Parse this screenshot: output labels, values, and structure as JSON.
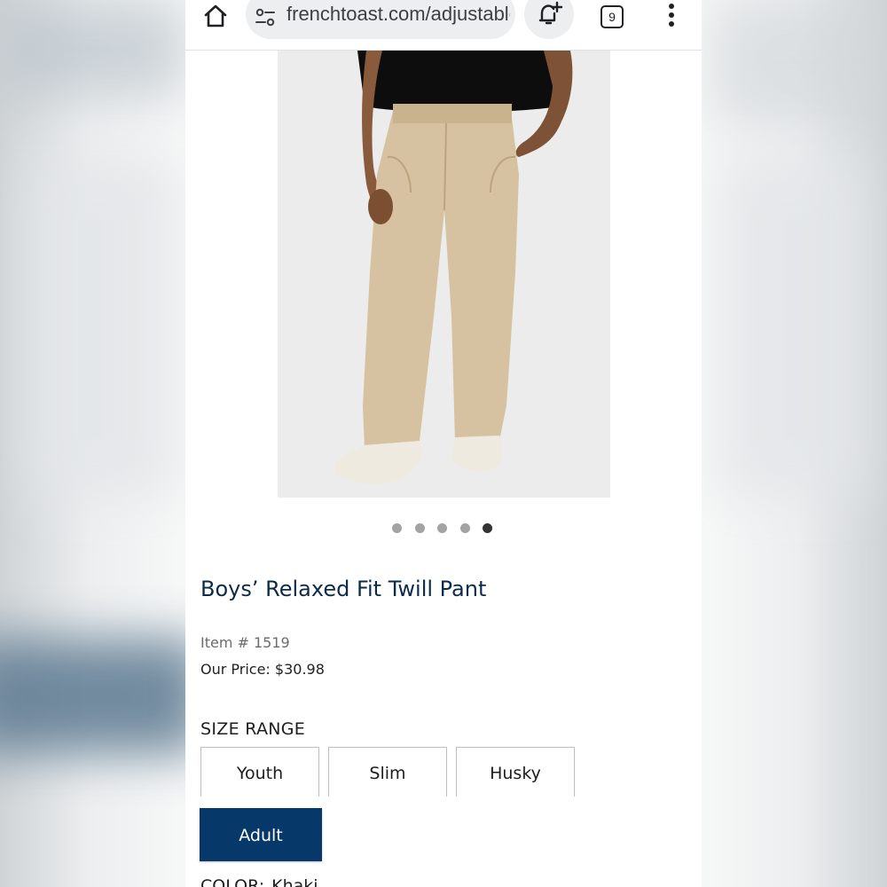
{
  "browser": {
    "url": "frenchtoast.com/adjustable",
    "tab_count": "9",
    "icons": {
      "home": "home-icon",
      "site_settings": "tune-icon",
      "notify": "add-alert-icon",
      "tabs": "tab-switcher-icon",
      "menu": "more-vert-icon"
    }
  },
  "product": {
    "title": "Boys’ Relaxed Fit Twill Pant",
    "item_number": "Item # 1519",
    "price": "Our Price: $30.98",
    "image": {
      "subject": "khaki pants worn by model",
      "carousel_count": 5,
      "carousel_active_index": 4
    }
  },
  "size_range": {
    "heading": "SIZE RANGE",
    "options": [
      "Youth",
      "Slim",
      "Husky",
      "Adult"
    ],
    "selected": "Adult"
  },
  "color": {
    "label": "COLOR:",
    "value": "Khaki"
  },
  "colors": {
    "primary_navy": "#06396a",
    "title_navy": "#0d2b47",
    "khaki": "#d3bf9d",
    "image_bg": "#ececec"
  }
}
